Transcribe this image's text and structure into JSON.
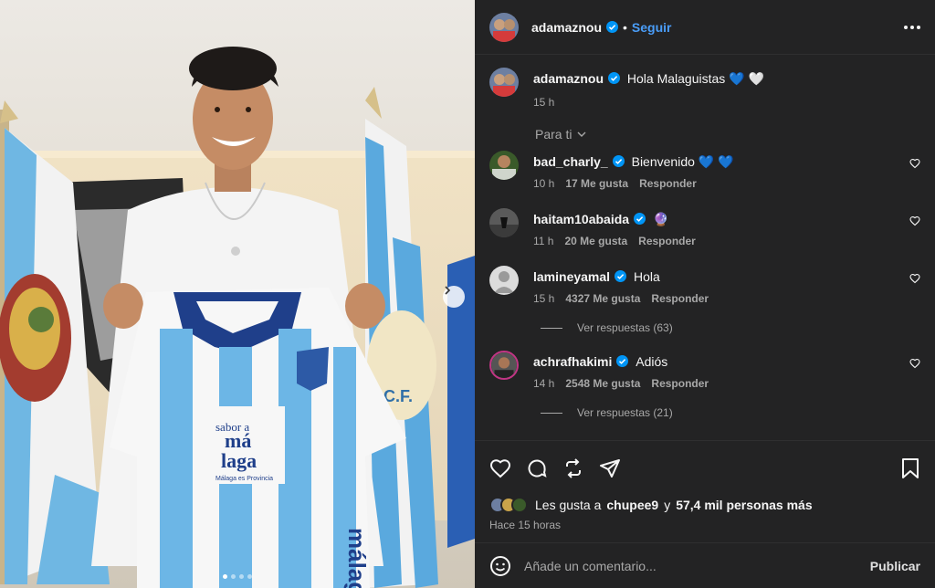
{
  "header": {
    "username": "adamaznou",
    "separator": "•",
    "follow_label": "Seguir"
  },
  "caption": {
    "username": "adamaznou",
    "text": "Hola Malaguistas 💙 🤍",
    "time": "15 h"
  },
  "filter_label": "Para ti",
  "comments": [
    {
      "username": "bad_charly_",
      "text": "Bienvenido 💙 💙",
      "time": "10 h",
      "likes": "17 Me gusta",
      "reply": "Responder",
      "avatar_color": "#3a5a2a"
    },
    {
      "username": "haitam10abaida",
      "text": "🔮",
      "time": "11 h",
      "likes": "20 Me gusta",
      "reply": "Responder",
      "avatar_color": "#444444"
    },
    {
      "username": "lamineyamal",
      "text": "Hola",
      "time": "15 h",
      "likes": "4327 Me gusta",
      "reply": "Responder",
      "avatar_color": "#dcdcdc"
    },
    {
      "username": "achrafhakimi",
      "text": "Adiós",
      "time": "14 h",
      "likes": "2548 Me gusta",
      "reply": "Responder",
      "avatar_color": "#555555"
    }
  ],
  "replies": [
    {
      "label": "Ver respuestas (63)"
    },
    {
      "label": "Ver respuestas (21)"
    }
  ],
  "likes_prefix": "Les gusta a",
  "likes_user": "chupee9",
  "likes_suffix": "y",
  "likes_count": "57,4 mil personas más",
  "post_time": "Hace 15 horas",
  "comment_placeholder": "Añade un comentario...",
  "publish_label": "Publicar",
  "colors": {
    "panel_bg": "#232324",
    "accent": "#4a9df8",
    "verified": "#0095f6",
    "muted": "#a8a8a8"
  },
  "icons": [
    "heart-icon",
    "comment-icon",
    "repost-icon",
    "share-icon",
    "bookmark-icon",
    "emoji-icon",
    "more-icon",
    "chevron-right-icon",
    "chevron-down-icon",
    "verified-icon"
  ]
}
